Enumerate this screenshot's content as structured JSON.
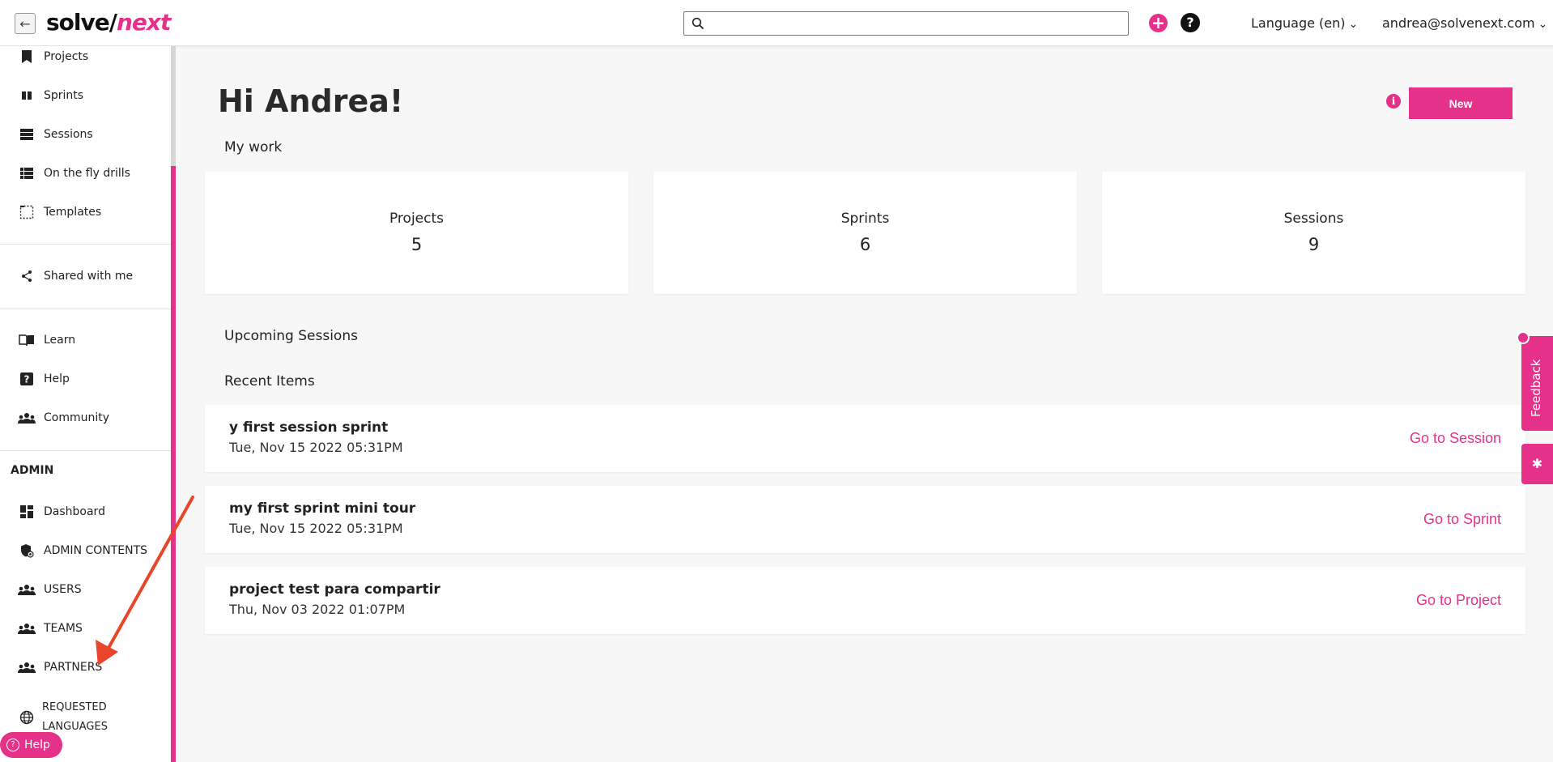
{
  "app": {
    "logo_part1": "solve/",
    "logo_part2": "next"
  },
  "header": {
    "search_placeholder": "",
    "add_icon": "plus-icon",
    "help_icon": "question-icon",
    "language_label": "Language (en)",
    "user_email": "andrea@solvenext.com"
  },
  "sidebar": {
    "items": [
      {
        "label": "Projects",
        "icon": "bookmark-icon"
      },
      {
        "label": "Sprints",
        "icon": "columns-icon"
      },
      {
        "label": "Sessions",
        "icon": "list-icon"
      },
      {
        "label": "On the fly drills",
        "icon": "list-detail-icon"
      },
      {
        "label": "Templates",
        "icon": "template-icon"
      },
      {
        "label": "Shared with me",
        "icon": "share-icon"
      },
      {
        "label": "Learn",
        "icon": "book-icon"
      },
      {
        "label": "Help",
        "icon": "help-icon"
      },
      {
        "label": "Community",
        "icon": "group-icon"
      }
    ],
    "admin_heading": "ADMIN",
    "admin_items": [
      {
        "label": "Dashboard",
        "icon": "dashboard-icon"
      },
      {
        "label": "ADMIN CONTENTS",
        "icon": "shield-icon"
      },
      {
        "label": "USERS",
        "icon": "group-icon"
      },
      {
        "label": "TEAMS",
        "icon": "group-icon"
      },
      {
        "label": "PARTNERS",
        "icon": "group-icon"
      }
    ],
    "requested_languages_line1": "REQUESTED",
    "requested_languages_line2": "LANGUAGES",
    "help_pill_label": "Help"
  },
  "main": {
    "greeting": "Hi Andrea!",
    "new_button": "New",
    "my_work_title": "My work",
    "stats": [
      {
        "label": "Projects",
        "value": "5"
      },
      {
        "label": "Sprints",
        "value": "6"
      },
      {
        "label": "Sessions",
        "value": "9"
      }
    ],
    "upcoming_title": "Upcoming Sessions",
    "recent_title": "Recent Items",
    "recent_items": [
      {
        "name": "y first session sprint",
        "date": "Tue, Nov 15 2022 05:31PM",
        "action": "Go to Session"
      },
      {
        "name": "my first sprint mini tour",
        "date": "Tue, Nov 15 2022 05:31PM",
        "action": "Go to Sprint"
      },
      {
        "name": "project test para compartir",
        "date": "Thu, Nov 03 2022 01:07PM",
        "action": "Go to Project"
      }
    ]
  },
  "feedback": {
    "label": "Feedback"
  },
  "colors": {
    "accent": "#e6318a",
    "arrow": "#e8452a"
  }
}
